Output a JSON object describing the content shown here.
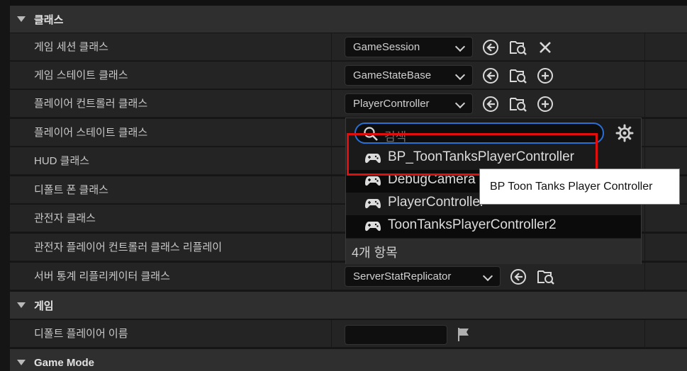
{
  "categories": {
    "classes": "클래스",
    "game": "게임",
    "game_mode": "Game Mode"
  },
  "rows": {
    "game_session": {
      "label": "게임 세션 클래스",
      "value": "GameSession"
    },
    "game_state": {
      "label": "게임 스테이트 클래스",
      "value": "GameStateBase"
    },
    "player_controller": {
      "label": "플레이어 컨트롤러 클래스",
      "value": "PlayerController"
    },
    "player_state": {
      "label": "플레이어 스테이트 클래스"
    },
    "hud": {
      "label": "HUD 클래스"
    },
    "default_pawn": {
      "label": "디폴트 폰 클래스"
    },
    "spectator": {
      "label": "관전자 클래스"
    },
    "replay_spectator": {
      "label": "관전자 플레이어 컨트롤러 클래스 리플레이"
    },
    "server_stat": {
      "label": "서버 통계 리플리케이터 클래스",
      "value": "ServerStatReplicator"
    },
    "default_player_name": {
      "label": "디폴트 플레이어 이름",
      "value": ""
    }
  },
  "dropdown": {
    "search_placeholder": "검색",
    "items": [
      "BP_ToonTanksPlayerController",
      "DebugCamera",
      "PlayerController",
      "ToonTanksPlayerController2"
    ],
    "footer": "4개 항목"
  },
  "tooltip": "BP Toon Tanks Player Controller",
  "icons": {
    "use": "arrow-left-circle-icon",
    "browse": "folder-search-icon",
    "clear": "close-icon",
    "add": "plus-circle-icon",
    "item": "gamepad-icon",
    "settings": "gear-icon",
    "flag": "flag-icon"
  },
  "colors": {
    "accent": "#2a6fd4",
    "highlight": "#e20d0d"
  }
}
